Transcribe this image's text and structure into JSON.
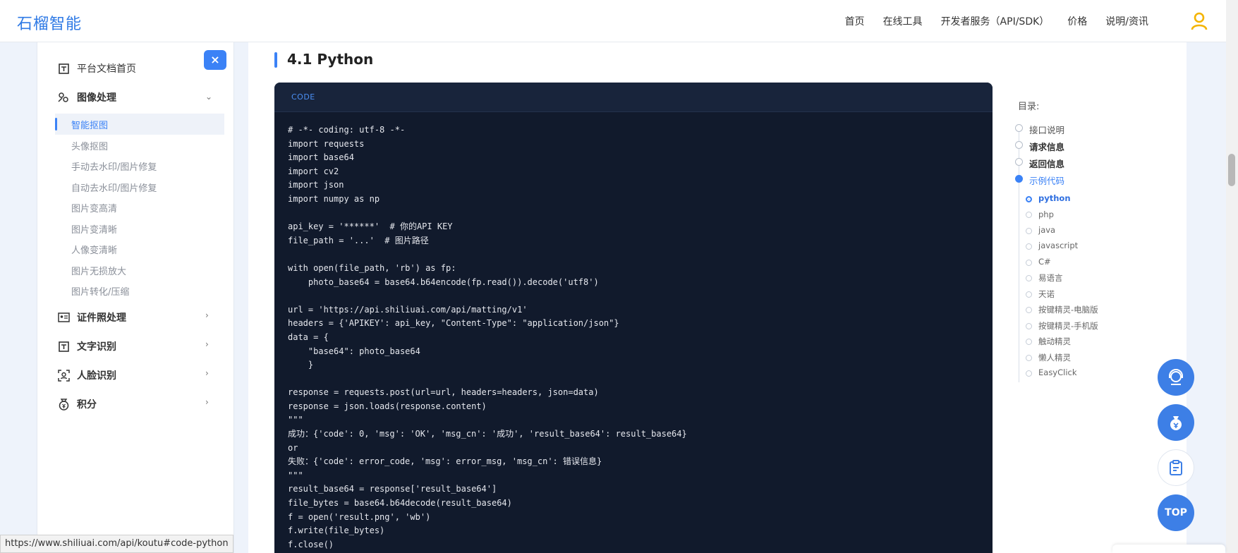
{
  "header": {
    "logo": "石榴智能",
    "nav": [
      "首页",
      "在线工具",
      "开发者服务（API/SDK）",
      "价格",
      "说明/资讯"
    ]
  },
  "sidebar": {
    "close_label": "×",
    "home": "平台文档首页",
    "groups": [
      {
        "label": "图像处理",
        "icon": "image-process-icon",
        "expanded": true
      },
      {
        "label": "证件照处理",
        "icon": "id-card-icon"
      },
      {
        "label": "文字识别",
        "icon": "text-recognition-icon"
      },
      {
        "label": "人脸识别",
        "icon": "face-recognition-icon"
      },
      {
        "label": "积分",
        "icon": "points-icon"
      }
    ],
    "sub_items": [
      "智能抠图",
      "头像抠图",
      "手动去水印/图片修复",
      "自动去水印/图片修复",
      "图片变高清",
      "图片变清晰",
      "人像变清晰",
      "图片无损放大",
      "图片转化/压缩"
    ],
    "active_sub": "智能抠图"
  },
  "main": {
    "section_title": "4.1 Python",
    "code_label": "CODE",
    "code": "# -*- coding: utf-8 -*-\nimport requests\nimport base64\nimport cv2\nimport json\nimport numpy as np\n\napi_key = '******'  # 你的API KEY\nfile_path = '...'  # 图片路径\n\nwith open(file_path, 'rb') as fp:\n    photo_base64 = base64.b64encode(fp.read()).decode('utf8')\n\nurl = 'https://api.shiliuai.com/api/matting/v1'\nheaders = {'APIKEY': api_key, \"Content-Type\": \"application/json\"}\ndata = {\n    \"base64\": photo_base64\n    }\n\nresponse = requests.post(url=url, headers=headers, json=data)\nresponse = json.loads(response.content)\n\"\"\"\n成功：{'code': 0, 'msg': 'OK', 'msg_cn': '成功', 'result_base64': result_base64}\nor\n失败：{'code': error_code, 'msg': error_msg, 'msg_cn': 错误信息}\n\"\"\"\nresult_base64 = response['result_base64']\nfile_bytes = base64.b64decode(result_base64)\nf = open('result.png', 'wb')\nf.write(file_bytes)\nf.close()"
  },
  "toc": {
    "title": "目录:",
    "items": [
      "接口说明",
      "请求信息",
      "返回信息",
      "示例代码"
    ],
    "active_item": "示例代码",
    "sub_items": [
      "python",
      "php",
      "java",
      "javascript",
      "C#",
      "易语言",
      "天诺",
      "按键精灵-电脑版",
      "按键精灵-手机版",
      "触动精灵",
      "懒人精灵",
      "EasyClick"
    ],
    "active_sub": "python"
  },
  "float_buttons": {
    "top_label": "TOP"
  },
  "status_bar": {
    "url": "https://www.shiliuai.com/api/koutu#code-python"
  },
  "colors": {
    "accent": "#3b82f6",
    "code_bg": "#111a2c",
    "page_bg": "#eef3fb"
  }
}
